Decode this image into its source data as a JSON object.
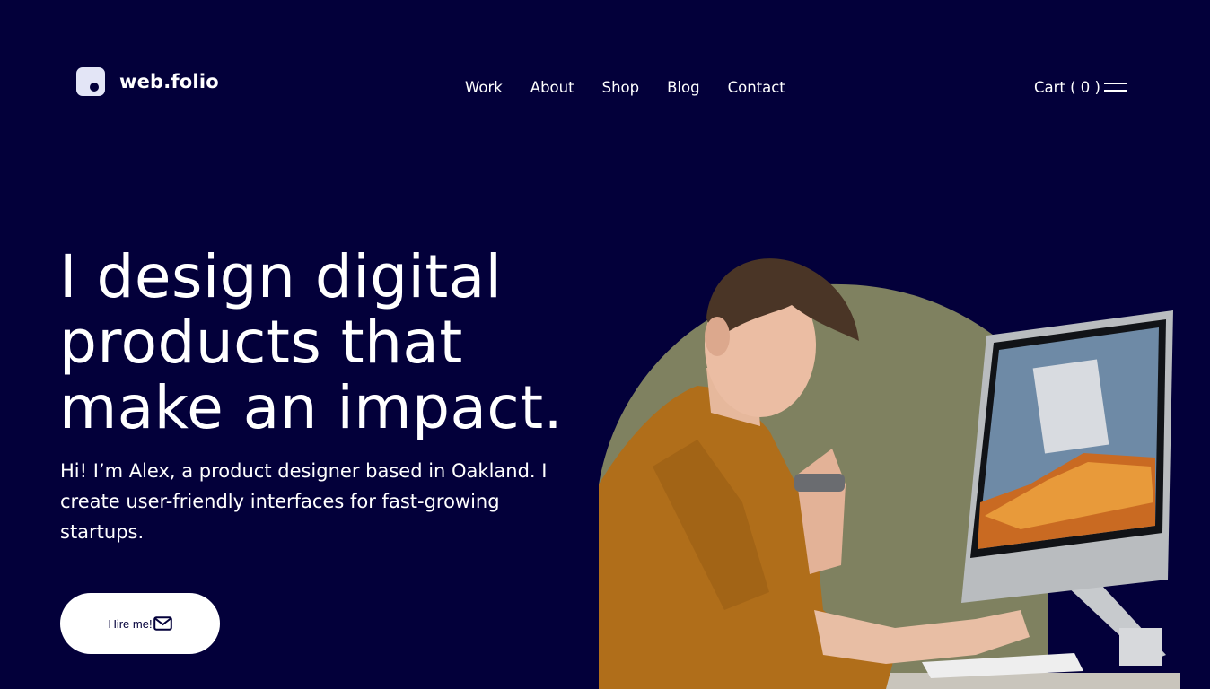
{
  "brand": {
    "name": "web.folio"
  },
  "nav": {
    "items": [
      "Work",
      "About",
      "Shop",
      "Blog",
      "Contact"
    ]
  },
  "header": {
    "cart_label": "Cart ( 0 )",
    "menu_icon": "hamburger-menu-icon"
  },
  "hero": {
    "title": "I design digital products that make an impact.",
    "description": "Hi! I’m Alex, a product designer based in Oakland. I create user-friendly interfaces for fast-growing startups.",
    "cta_label": "Hire me!",
    "cta_icon": "envelope-icon",
    "image": "photo-designer-at-desk-with-computer"
  },
  "colors": {
    "background": "#03003a",
    "text": "#ffffff",
    "button_bg": "#ffffff",
    "accent_circle": "#7f8160"
  }
}
